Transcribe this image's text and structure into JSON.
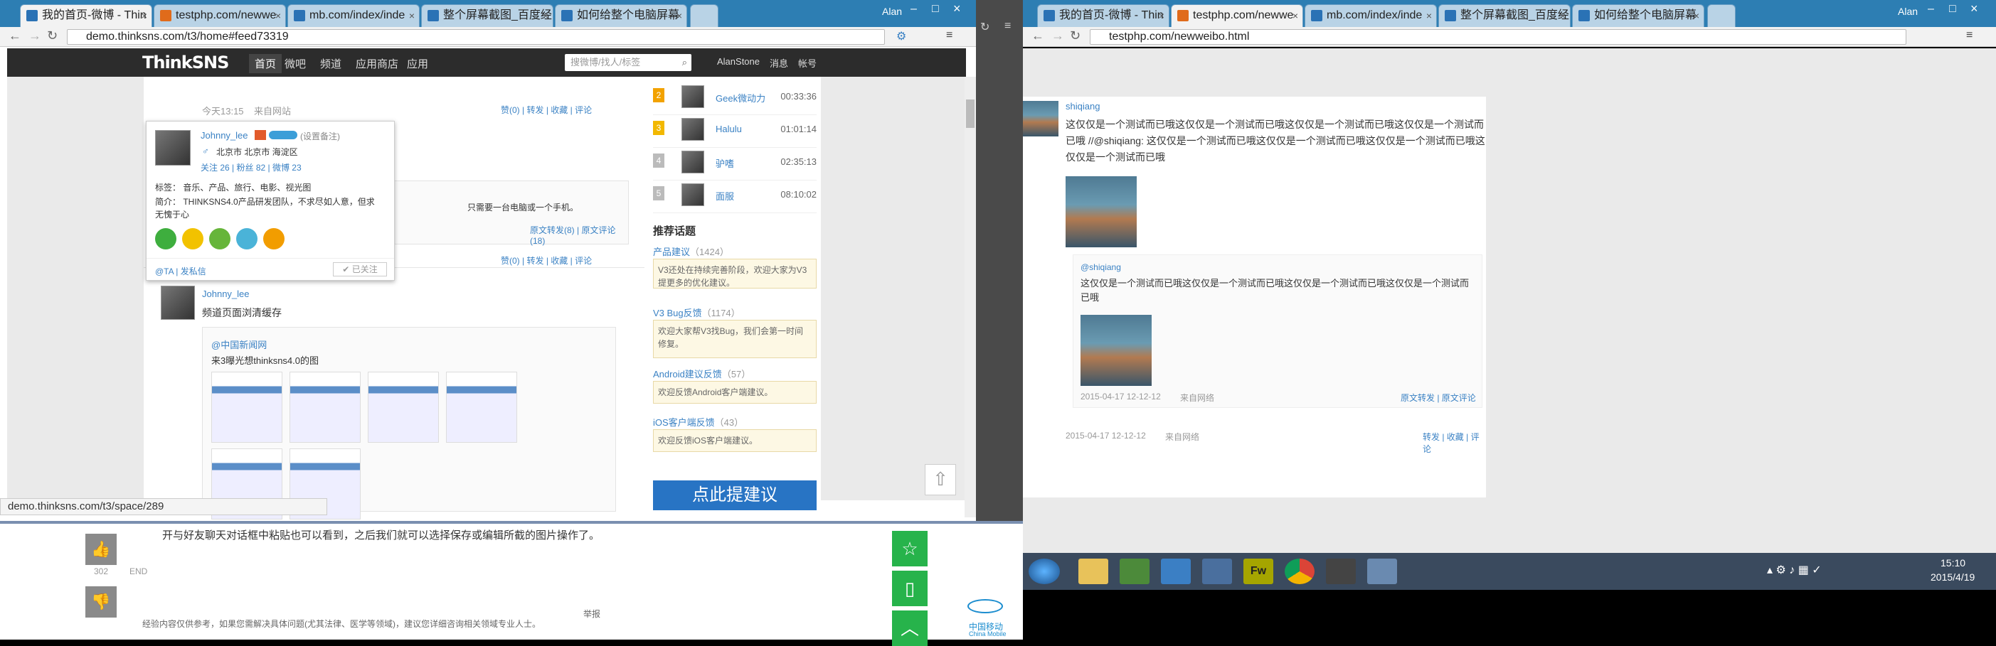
{
  "left_window": {
    "tabs": [
      "我的首页-微博 - Thin",
      "testphp.com/newwe",
      "mb.com/index/inde",
      "整个屏幕截图_百度经",
      "如何给整个电脑屏幕"
    ],
    "user": "Alan",
    "url": "demo.thinksns.com/t3/home#feed73319",
    "status_url": "demo.thinksns.com/t3/space/289"
  },
  "thinksns": {
    "logo": "ThinkSNS",
    "nav": [
      "首页",
      "微吧",
      "频道",
      "应用商店",
      "应用"
    ],
    "search_placeholder": "搜微博/找人/标签",
    "user_links": [
      "AlanStone",
      "消息",
      "帐号"
    ]
  },
  "feed": {
    "top_meta_time": "今天13:15",
    "top_meta_source": "来自网站",
    "actions": [
      "赞(0)",
      "转发",
      "收藏",
      "评论"
    ],
    "repost_snippet": "只需要一台电脑或一个手机。",
    "repost_actions": [
      "原文转发(8)",
      "原文评论(18)"
    ],
    "post2_user": "Johnny_lee",
    "post2_text": "频道页面浏清缓存",
    "post2_repost_user": "@中国新闻网",
    "post2_repost_text": "来3曝光想thinksns4.0的图"
  },
  "card": {
    "name": "Johnny_lee",
    "remark": "(设置备注)",
    "location": "北京市 北京市 海淀区",
    "follow_label": "关注 26",
    "fans_label": "粉丝 82",
    "weibo_label": "微博 23",
    "tags": "标签： 音乐、产品、旅行、电影、视光图",
    "intro": "简介： THINKSNS4.0产品研发团队，不求尽如人意，但求无愧于心",
    "bottom_left": "@TA | 发私信",
    "followed": "已关注"
  },
  "side": {
    "ranks": [
      {
        "num": "2",
        "name": "Geek微动力",
        "time": "00:33:36"
      },
      {
        "num": "3",
        "name": "Halulu",
        "time": "01:01:14"
      },
      {
        "num": "4",
        "name": "驴嗜",
        "time": "02:35:13"
      },
      {
        "num": "5",
        "name": "面服",
        "time": "08:10:02"
      }
    ],
    "topics_title": "推荐话题",
    "topics": [
      {
        "title": "产品建议",
        "count": "（1424）",
        "body": "V3还处在持续完善阶段，欢迎大家为V3提更多的优化建议。"
      },
      {
        "title": "V3 Bug反馈",
        "count": "（1174）",
        "body": "欢迎大家帮V3找Bug，我们会第一时间修复。"
      },
      {
        "title": "Android建议反馈",
        "count": "（57）",
        "body": "欢迎反馈Android客户端建议。"
      },
      {
        "title": "iOS客户端反馈",
        "count": "（43）",
        "body": "欢迎反馈iOS客户端建议。"
      }
    ],
    "big_button": "点此提建议"
  },
  "baidu": {
    "text": "开与好友聊天对话框中粘贴也可以看到，之后我们就可以选择保存或编辑所截的图片操作了。",
    "vote_count": "302",
    "end": "END",
    "disclaimer": "经验内容仅供参考，如果您需解决具体问题(尤其法律、医学等领域)，建议您详细咨询相关领域专业人士。",
    "report": "举报",
    "brand": "中国移动",
    "brand_en": "China Mobile"
  },
  "right_window": {
    "tabs": [
      "我的首页-微博 - Thin",
      "testphp.com/newwe",
      "mb.com/index/inde",
      "整个屏幕截图_百度经",
      "如何给整个电脑屏幕"
    ],
    "user": "Alan",
    "url": "testphp.com/newweibo.html",
    "post": {
      "user": "shiqiang",
      "text": "这仅仅是一个测试而已哦这仅仅是一个测试而已哦这仅仅是一个测试而已哦这仅仅是一个测试而已哦 //@shiqiang: 这仅仅是一个测试而已哦这仅仅是一个测试而已哦这仅仅是一个测试而已哦这仅仅是一个测试而已哦",
      "repost_user": "@shiqiang",
      "repost_text": "这仅仅是一个测试而已哦这仅仅是一个测试而已哦这仅仅是一个测试而已哦这仅仅是一个测试而已哦",
      "repost_time": "2015-04-17 12-12-12",
      "repost_source": "来自网络",
      "repost_actions": "原文转发 | 原文评论",
      "time": "2015-04-17 12-12-12",
      "source": "来自网络",
      "actions": "转发 | 收藏 | 评论"
    },
    "clock_time": "15:10",
    "clock_date": "2015/4/19"
  }
}
